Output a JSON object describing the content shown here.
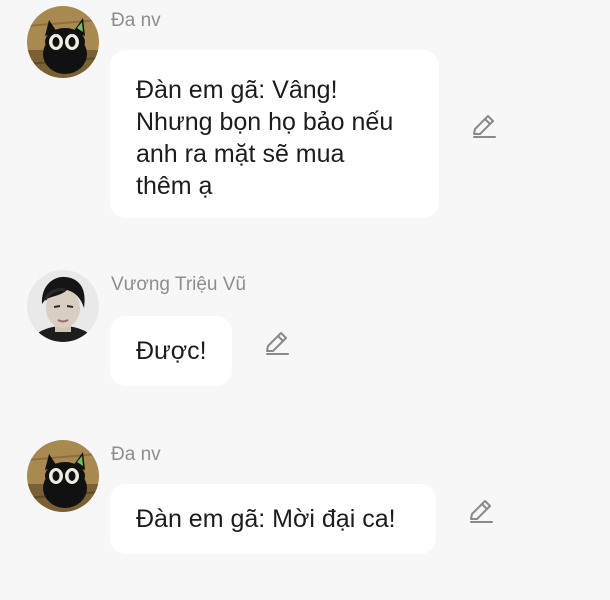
{
  "messages": [
    {
      "sender": "Đa nv",
      "avatar_icon": "cat-avatar-icon",
      "text": "Đàn em gã: Vâng!\nNhưng bọn họ bảo nếu\nanh ra mặt sẽ mua\nthêm ạ",
      "edit_icon": "pencil-icon"
    },
    {
      "sender": "Vương Triệu Vũ",
      "avatar_icon": "person-avatar-icon",
      "text": "Được!",
      "edit_icon": "pencil-icon"
    },
    {
      "sender": "Đa nv",
      "avatar_icon": "cat-avatar-icon",
      "text": "Đàn em gã: Mời đại ca!",
      "edit_icon": "pencil-icon"
    }
  ],
  "colors": {
    "background": "#f7f7f7",
    "bubble": "#ffffff",
    "sender_text": "#8e8e8e",
    "message_text": "#1c1c1c",
    "icon": "#8a8a8a"
  }
}
